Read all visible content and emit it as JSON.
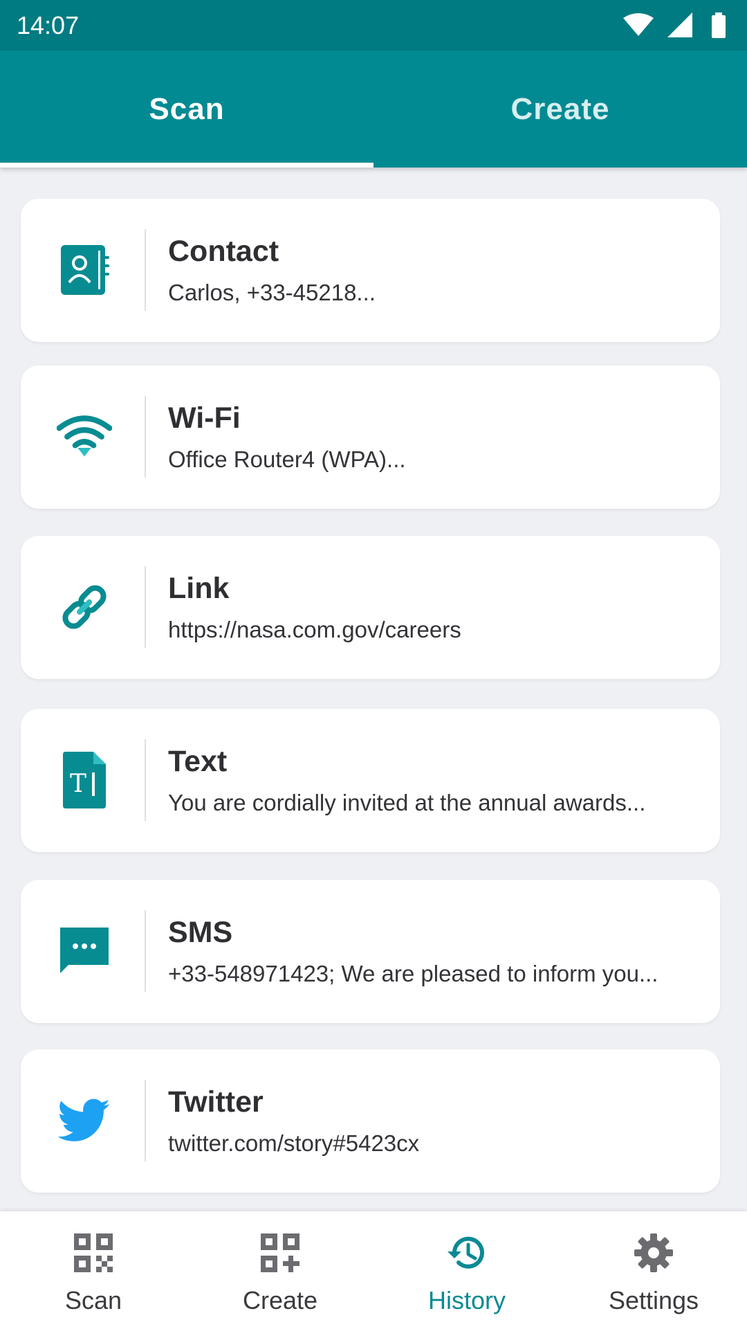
{
  "status_bar": {
    "time": "14:07",
    "icons": [
      "wifi-icon",
      "cell-signal-icon",
      "battery-icon"
    ]
  },
  "tabs": [
    {
      "label": "Scan",
      "active": true
    },
    {
      "label": "Create",
      "active": false
    }
  ],
  "history_items": [
    {
      "type": "Contact",
      "icon": "contact-book-icon",
      "detail": "Carlos, +33-45218..."
    },
    {
      "type": "Wi-Fi",
      "icon": "wifi-icon",
      "detail": "Office Router4 (WPA)..."
    },
    {
      "type": "Link",
      "icon": "link-icon",
      "detail": "https://nasa.com.gov/careers"
    },
    {
      "type": "Text",
      "icon": "text-document-icon",
      "detail": "You are cordially invited at the annual awards..."
    },
    {
      "type": "SMS",
      "icon": "message-icon",
      "detail": "+33-548971423; We are pleased to inform you..."
    },
    {
      "type": "Twitter",
      "icon": "twitter-bird-icon",
      "detail": "twitter.com/story#5423cx"
    }
  ],
  "bottom_nav": [
    {
      "label": "Scan",
      "icon": "qr-code-icon",
      "active": false
    },
    {
      "label": "Create",
      "icon": "qr-add-icon",
      "active": false
    },
    {
      "label": "History",
      "icon": "history-icon",
      "active": true
    },
    {
      "label": "Settings",
      "icon": "gear-icon",
      "active": false
    }
  ],
  "colors": {
    "status_bar": "#017b82",
    "app_bar": "#028a92",
    "accent": "#0a8a93",
    "twitter": "#1da1f2",
    "background": "#eef0f4"
  }
}
